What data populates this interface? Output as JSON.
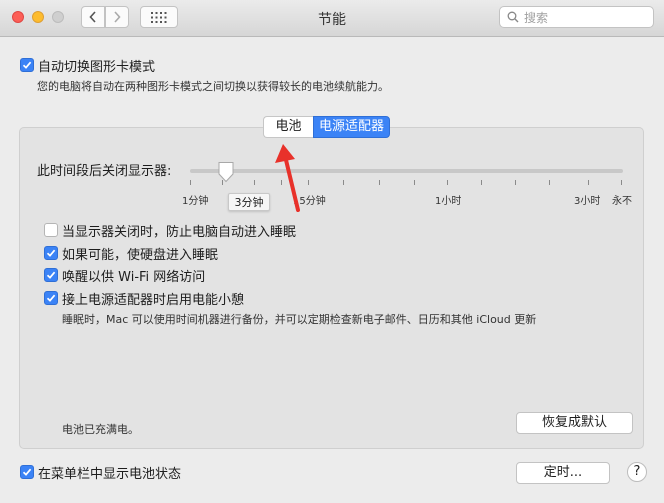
{
  "window": {
    "title": "节能"
  },
  "search": {
    "placeholder": "搜索"
  },
  "auto_switch": {
    "label": "自动切换图形卡模式",
    "checked": true,
    "description": "您的电脑将自动在两种图形卡模式之间切换以获得较长的电池续航能力。"
  },
  "tabs": [
    {
      "label": "电池",
      "selected": false
    },
    {
      "label": "电源适配器",
      "selected": true
    }
  ],
  "display_sleep": {
    "label": "此时间段后关闭显示器:",
    "tick_labels": [
      "1分钟",
      "15分钟",
      "1小时",
      "3小时",
      "永不"
    ],
    "value": "3分钟"
  },
  "options": [
    {
      "label": "当显示器关闭时，防止电脑自动进入睡眠",
      "checked": false
    },
    {
      "label": "如果可能，使硬盘进入睡眠",
      "checked": true
    },
    {
      "label": "唤醒以供 Wi-Fi 网络访问",
      "checked": true
    },
    {
      "label": "接上电源适配器时启用电能小憩",
      "checked": true
    }
  ],
  "power_nap_note": "睡眠时，Mac 可以使用时间机器进行备份，并可以定期检查新电子邮件、日历和其他 iCloud 更新",
  "battery_status": "电池已充满电。",
  "restore_defaults": "恢复成默认",
  "show_menu_bar": {
    "label": "在菜单栏中显示电池状态",
    "checked": true
  },
  "schedule_button": "定时...",
  "help": "?",
  "accent_color": "#3b83f6",
  "annotation_color": "#e8312a"
}
